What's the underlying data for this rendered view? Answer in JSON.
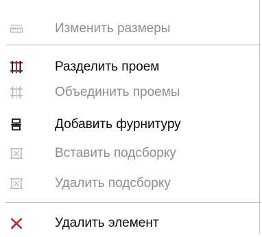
{
  "menu": {
    "items": [
      {
        "label": "Изменить размеры",
        "icon": "resize-icon",
        "enabled": false
      },
      {
        "label": "Разделить проем",
        "icon": "split-opening-icon",
        "enabled": true
      },
      {
        "label": "Объединить проемы",
        "icon": "merge-openings-icon",
        "enabled": false
      },
      {
        "label": "Добавить фурнитуру",
        "icon": "add-hardware-icon",
        "enabled": true
      },
      {
        "label": "Вставить подсборку",
        "icon": "insert-subassembly-icon",
        "enabled": false
      },
      {
        "label": "Удалить подсборку",
        "icon": "delete-subassembly-icon",
        "enabled": false
      },
      {
        "label": "Удалить элемент",
        "icon": "delete-element-icon",
        "enabled": true
      }
    ]
  },
  "colors": {
    "enabled_text": "#0b0b0b",
    "disabled_text": "#8f8f8f",
    "delete_accent": "#c62828"
  }
}
